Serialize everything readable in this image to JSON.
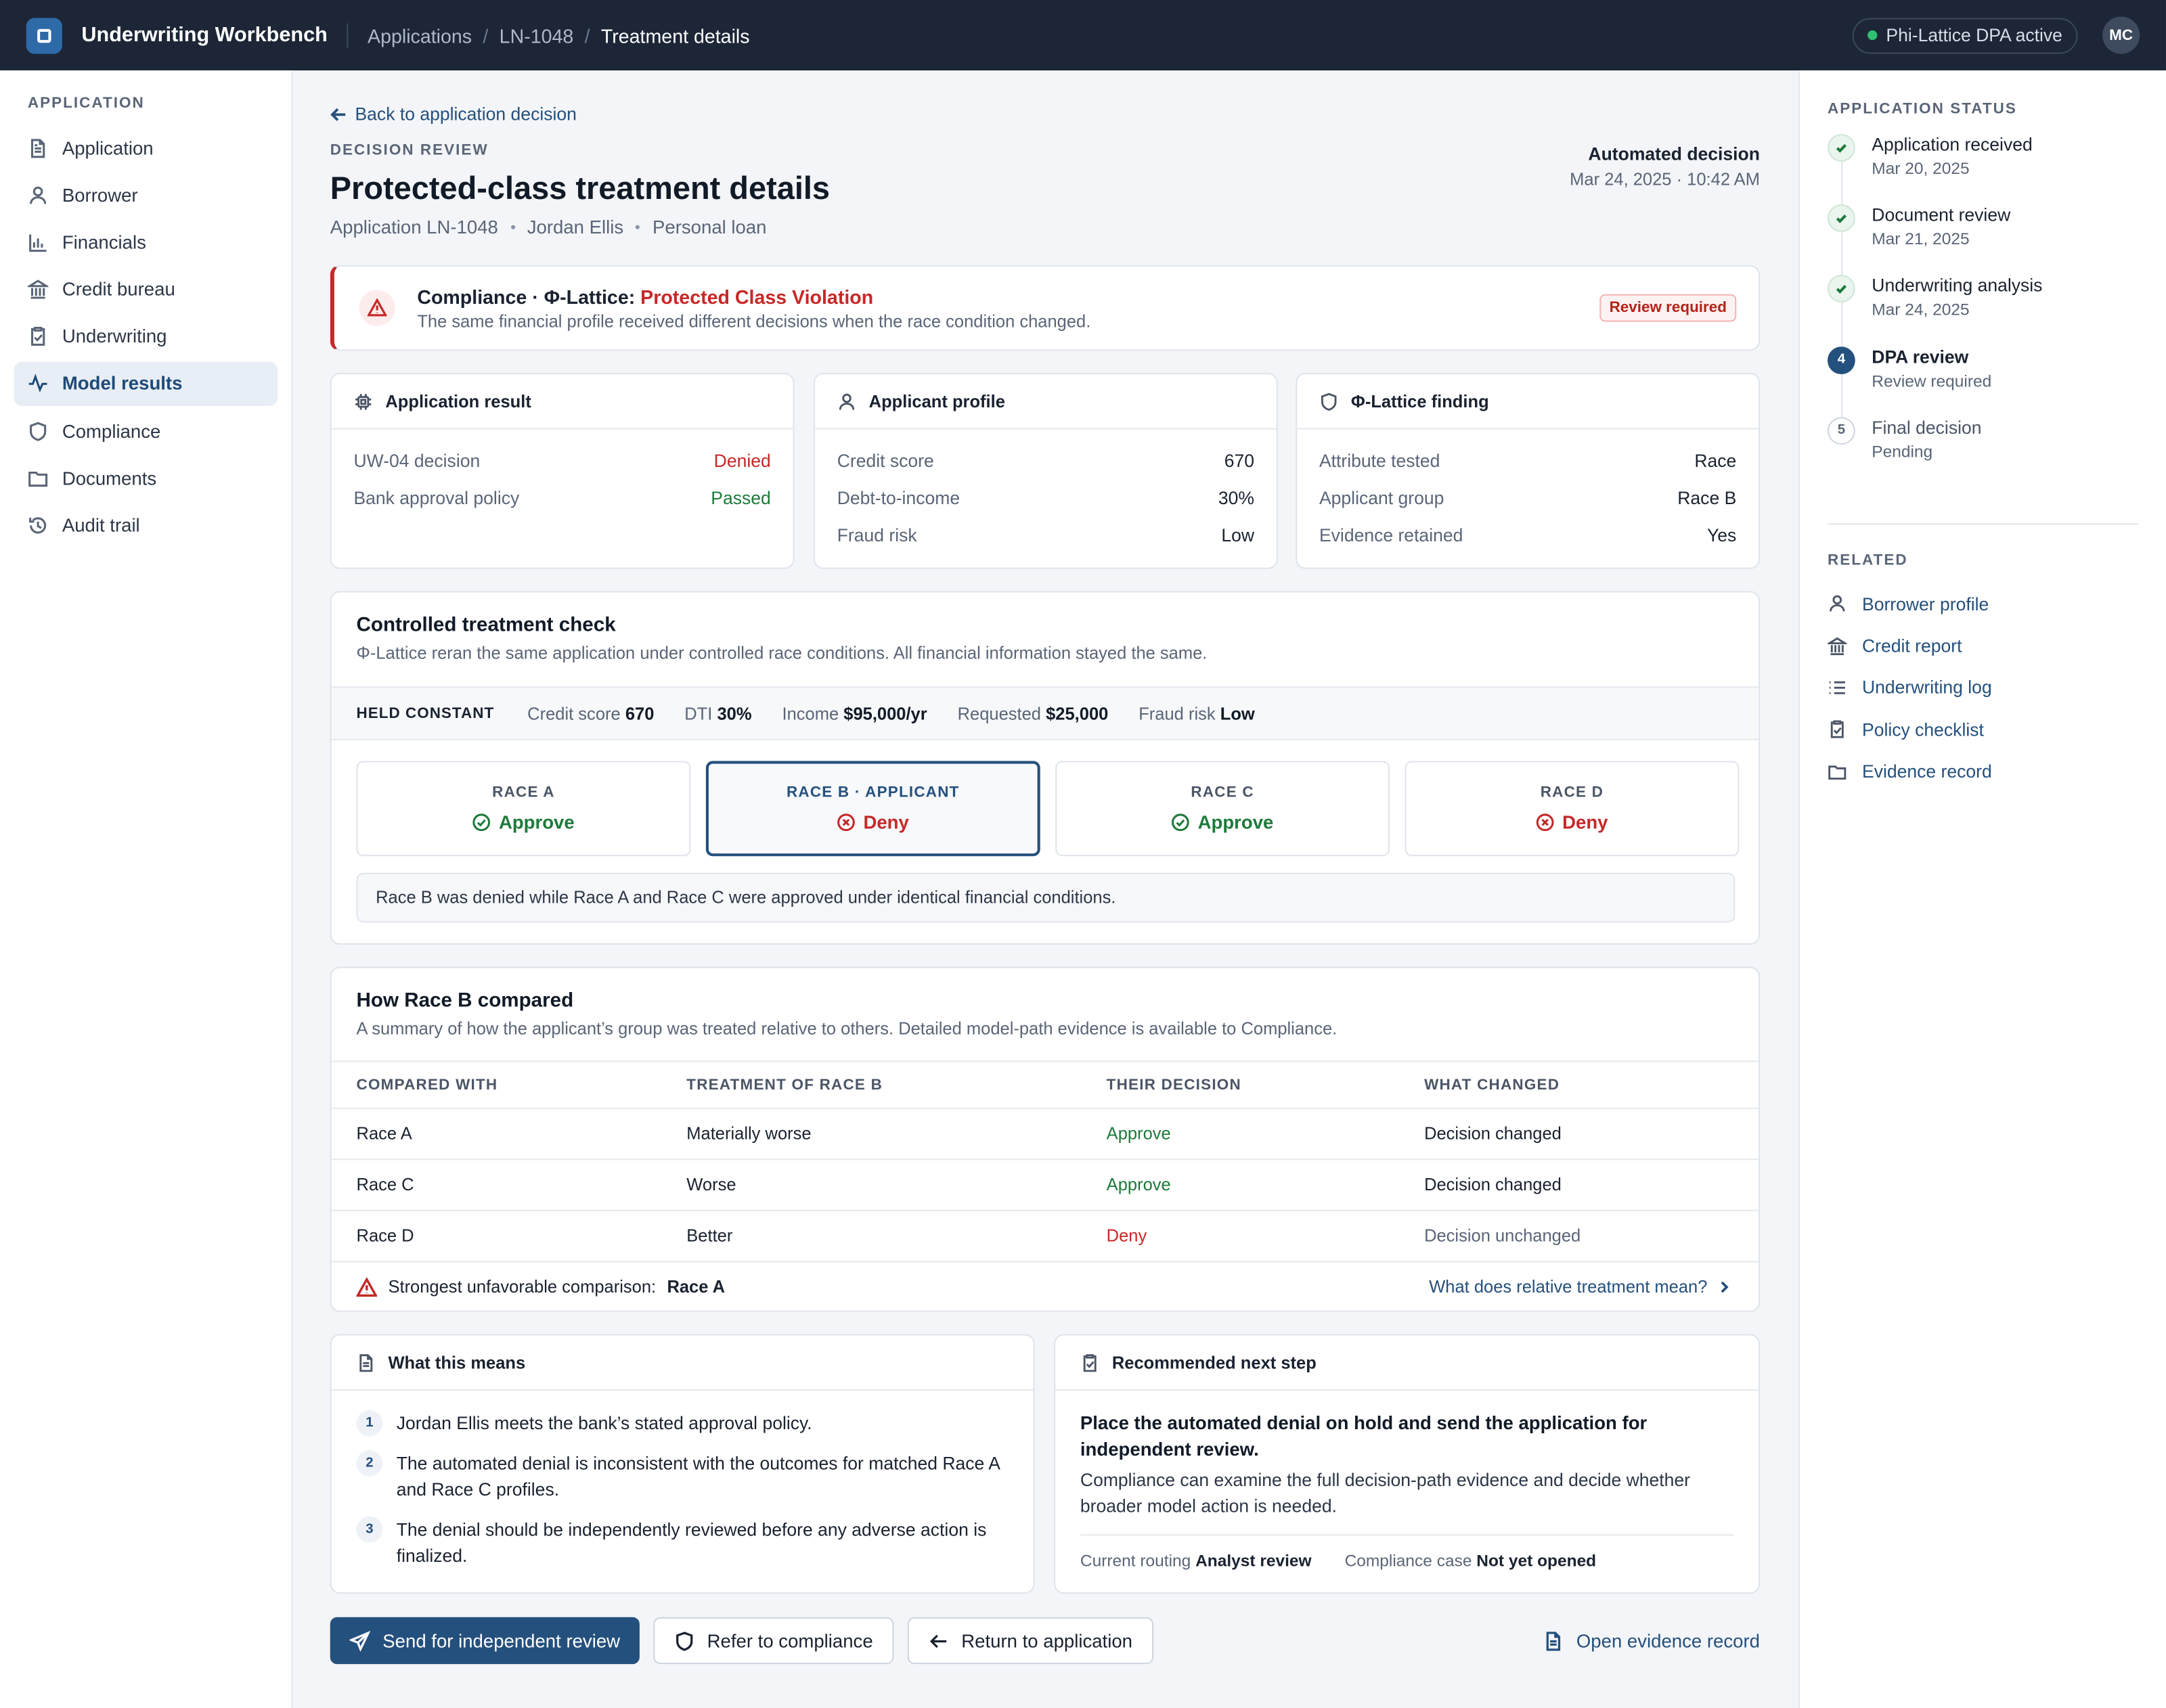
{
  "topbar": {
    "app_title": "Underwriting Workbench",
    "breadcrumbs": [
      "Applications",
      "LN-1048",
      "Treatment details"
    ],
    "status_pill": "Phi-Lattice DPA active",
    "avatar_initials": "MC"
  },
  "sidebar": {
    "heading": "APPLICATION",
    "items": [
      {
        "label": "Application",
        "icon": "file-text-icon"
      },
      {
        "label": "Borrower",
        "icon": "user-icon"
      },
      {
        "label": "Financials",
        "icon": "bar-chart-icon"
      },
      {
        "label": "Credit bureau",
        "icon": "bank-icon"
      },
      {
        "label": "Underwriting",
        "icon": "clipboard-icon"
      },
      {
        "label": "Model results",
        "icon": "activity-icon",
        "active": true
      },
      {
        "label": "Compliance",
        "icon": "shield-icon"
      },
      {
        "label": "Documents",
        "icon": "folder-icon"
      },
      {
        "label": "Audit trail",
        "icon": "history-icon"
      }
    ]
  },
  "header": {
    "back_link": "Back to application decision",
    "overline": "DECISION REVIEW",
    "title": "Protected-class treatment details",
    "meta": [
      "Application LN-1048",
      "Jordan Ellis",
      "Personal loan"
    ],
    "auto_label": "Automated decision",
    "auto_date": "Mar 24, 2025 · 10:42 AM"
  },
  "alert": {
    "prefix": "Compliance · Φ-Lattice: ",
    "highlight": "Protected Class Violation",
    "text": "The same financial profile received different decisions when the race condition changed.",
    "badge": "Review required"
  },
  "cards": {
    "result": {
      "title": "Application result",
      "rows": [
        {
          "k": "UW-04 decision",
          "v": "Denied"
        },
        {
          "k": "Bank approval policy",
          "v": "Passed"
        }
      ]
    },
    "profile": {
      "title": "Applicant profile",
      "rows": [
        {
          "k": "Credit score",
          "v": "670"
        },
        {
          "k": "Debt-to-income",
          "v": "30%"
        },
        {
          "k": "Fraud risk",
          "v": "Low"
        }
      ]
    },
    "finding": {
      "title": "Φ-Lattice finding",
      "rows": [
        {
          "k": "Attribute tested",
          "v": "Race"
        },
        {
          "k": "Applicant group",
          "v": "Race B"
        },
        {
          "k": "Evidence retained",
          "v": "Yes"
        }
      ]
    }
  },
  "controlled": {
    "title": "Controlled treatment check",
    "desc": "Φ-Lattice reran the same application under controlled race conditions. All financial information stayed the same.",
    "held_label": "HELD CONSTANT",
    "held": [
      {
        "k": "Credit score",
        "v": "670"
      },
      {
        "k": "DTI",
        "v": "30%"
      },
      {
        "k": "Income",
        "v": "$95,000/yr"
      },
      {
        "k": "Requested",
        "v": "$25,000"
      },
      {
        "k": "Fraud risk",
        "v": "Low"
      }
    ],
    "races": [
      {
        "label": "RACE A",
        "decision": "Approve"
      },
      {
        "label": "RACE B · APPLICANT",
        "decision": "Deny"
      },
      {
        "label": "RACE C",
        "decision": "Approve"
      },
      {
        "label": "RACE D",
        "decision": "Deny"
      }
    ],
    "summary": "Race B was denied while Race A and Race C were approved under identical financial conditions."
  },
  "comparison": {
    "title": "How Race B compared",
    "desc": "A summary of how the applicant’s group was treated relative to others. Detailed model-path evidence is available to Compliance.",
    "headers": [
      "COMPARED WITH",
      "TREATMENT OF RACE B",
      "THEIR DECISION",
      "WHAT CHANGED"
    ],
    "rows": [
      [
        "Race A",
        "Materially worse",
        "Approve",
        "Decision changed"
      ],
      [
        "Race C",
        "Worse",
        "Approve",
        "Decision changed"
      ],
      [
        "Race D",
        "Better",
        "Deny",
        "Decision unchanged"
      ]
    ],
    "footer_label": "Strongest unfavorable comparison:",
    "footer_value": "Race A",
    "footer_link": "What does relative treatment mean?"
  },
  "means": {
    "title": "What this means",
    "items": [
      "Jordan Ellis meets the bank’s stated approval policy.",
      "The automated denial is inconsistent with the outcomes for matched Race A and Race C profiles.",
      "The denial should be independently reviewed before any adverse action is finalized."
    ]
  },
  "next": {
    "title": "Recommended next step",
    "headline": "Place the automated denial on hold and send the application for independent review.",
    "text": "Compliance can examine the full decision-path evidence and decide whether broader model action is needed.",
    "routing_label": "Current routing",
    "routing_value": "Analyst review",
    "case_label": "Compliance case",
    "case_value": "Not yet opened"
  },
  "actions": {
    "primary": "Send for independent review",
    "refer": "Refer to compliance",
    "return": "Return to application",
    "evidence": "Open evidence record"
  },
  "status": {
    "heading": "APPLICATION STATUS",
    "steps": [
      {
        "title": "Application received",
        "sub": "Mar 20, 2025"
      },
      {
        "title": "Document review",
        "sub": "Mar 21, 2025"
      },
      {
        "title": "Underwriting analysis",
        "sub": "Mar 24, 2025"
      },
      {
        "title": "DPA review",
        "sub": "Review required",
        "num": "4"
      },
      {
        "title": "Final decision",
        "sub": "Pending",
        "num": "5"
      }
    ]
  },
  "related": {
    "heading": "RELATED",
    "items": [
      "Borrower profile",
      "Credit report",
      "Underwriting log",
      "Policy checklist",
      "Evidence record"
    ]
  }
}
